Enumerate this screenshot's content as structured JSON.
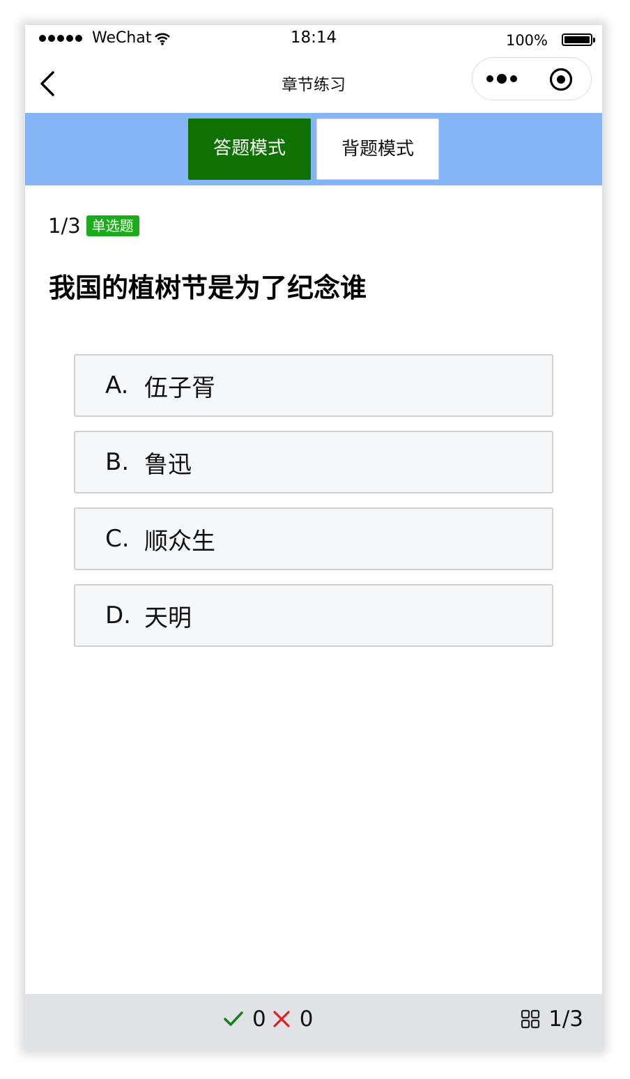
{
  "status_bar": {
    "carrier": "WeChat",
    "time": "18:14",
    "battery": "100%"
  },
  "nav": {
    "title": "章节练习"
  },
  "modes": {
    "answer_mode": "答题模式",
    "review_mode": "背题模式"
  },
  "question": {
    "index": "1/3",
    "type": "单选题",
    "title": "我国的植树节是为了纪念谁",
    "options": [
      {
        "letter": "A.",
        "text": "伍子胥"
      },
      {
        "letter": "B.",
        "text": "鲁迅"
      },
      {
        "letter": "C.",
        "text": "顺众生"
      },
      {
        "letter": "D.",
        "text": "天明"
      }
    ]
  },
  "footer": {
    "correct_count": "0",
    "wrong_count": "0",
    "progress": "1/3",
    "correct_color": "#1a7f1a",
    "wrong_color": "#e02020"
  }
}
